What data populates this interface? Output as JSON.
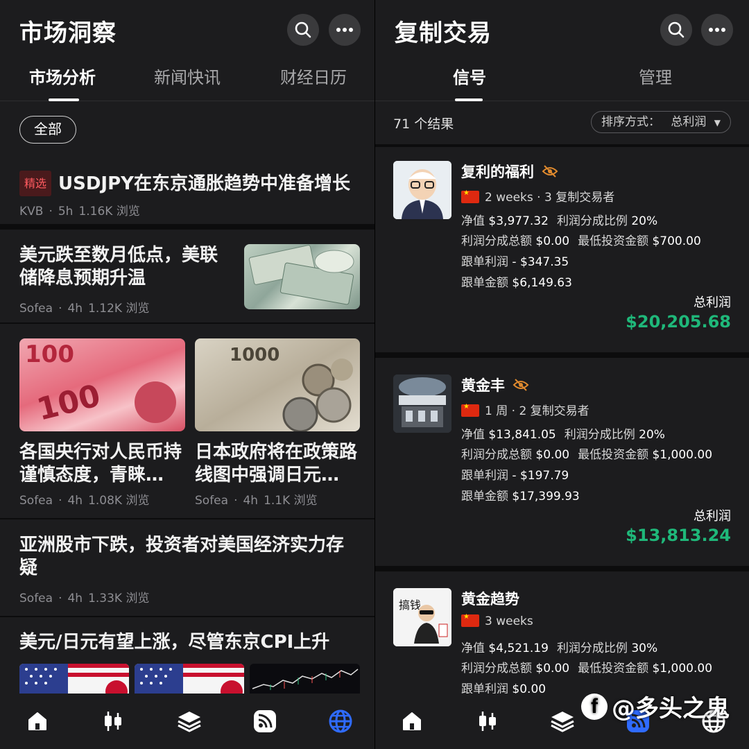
{
  "left": {
    "title": "市场洞察",
    "tabs": [
      "市场分析",
      "新闻快讯",
      "财经日历"
    ],
    "filter_chip": "全部",
    "articles": [
      {
        "badge": "精选",
        "title": "USDJPY在东京通胀趋势中准备增长",
        "author": "KVB",
        "age": "5h",
        "views": "1.16K 浏览"
      },
      {
        "title": "美元跌至数月低点，美联储降息预期升温",
        "author": "Sofea",
        "age": "4h",
        "views": "1.12K 浏览",
        "image": "us-dollar-bills"
      },
      {
        "title": "各国央行对人民币持谨慎态度，青睐…",
        "author": "Sofea",
        "age": "4h",
        "views": "1.08K 浏览",
        "image": "yuan-banknotes"
      },
      {
        "title": "日本政府将在政策路线图中强调日元…",
        "author": "Sofea",
        "age": "4h",
        "views": "1.1K 浏览",
        "image": "yen-banknotes-coins"
      },
      {
        "title": "亚洲股市下跌，投资者对美国经济实力存疑",
        "author": "Sofea",
        "age": "4h",
        "views": "1.33K 浏览"
      },
      {
        "title": "美元/日元有望上涨，尽管东京CPI上升",
        "images": [
          "us-japan-flags",
          "us-japan-flags",
          "price-chart"
        ]
      }
    ]
  },
  "right": {
    "title": "复制交易",
    "tabs": [
      "信号",
      "管理"
    ],
    "result_count": "71 个结果",
    "sort_label": "排序方式：",
    "sort_value": "总利润",
    "cards": [
      {
        "name": "复利的福利",
        "duration": "2 weeks",
        "copiers": "3 复制交易者",
        "net_label": "净值",
        "net": "$3,977.32",
        "share_label": "利润分成比例",
        "share": "20%",
        "share_total_label": "利润分成总额",
        "share_total": "$0.00",
        "min_label": "最低投资金额",
        "min": "$700.00",
        "copy_profit_label": "跟单利润",
        "copy_profit": "- $347.35",
        "copy_amount_label": "跟单金额",
        "copy_amount": "$6,149.63",
        "total_label": "总利润",
        "total": "$20,205.68",
        "avatar": "cartoon-old-man-glasses"
      },
      {
        "name": "黄金丰",
        "duration": "1 周",
        "copiers": "2 复制交易者",
        "net_label": "净值",
        "net": "$13,841.05",
        "share_label": "利润分成比例",
        "share": "20%",
        "share_total_label": "利润分成总额",
        "share_total": "$0.00",
        "min_label": "最低投资金额",
        "min": "$1,000.00",
        "copy_profit_label": "跟单利润",
        "copy_profit": "- $197.79",
        "copy_amount_label": "跟单金额",
        "copy_amount": "$17,399.93",
        "total_label": "总利润",
        "total": "$13,813.24",
        "avatar": "trading-floor"
      },
      {
        "name": "黄金趋势",
        "duration": "3 weeks",
        "copiers": "",
        "net_label": "净值",
        "net": "$4,521.19",
        "share_label": "利润分成比例",
        "share": "30%",
        "share_total_label": "利润分成总额",
        "share_total": "$0.00",
        "min_label": "最低投资金额",
        "min": "$1,000.00",
        "copy_profit_label": "跟单利润",
        "copy_profit": "$0.00",
        "avatar_text": "搞钱",
        "avatar": "cartoon-man-sunglasses"
      }
    ]
  },
  "bottom_nav": [
    "home-icon",
    "candlestick-icon",
    "layers-icon",
    "rss-icon",
    "globe-icon"
  ],
  "watermark": "@多头之鬼",
  "colors": {
    "accent_blue": "#2f6bff",
    "profit_green": "#1fb87a",
    "badge_red": "#ff5a5f",
    "bg": "#1c1c1e"
  }
}
